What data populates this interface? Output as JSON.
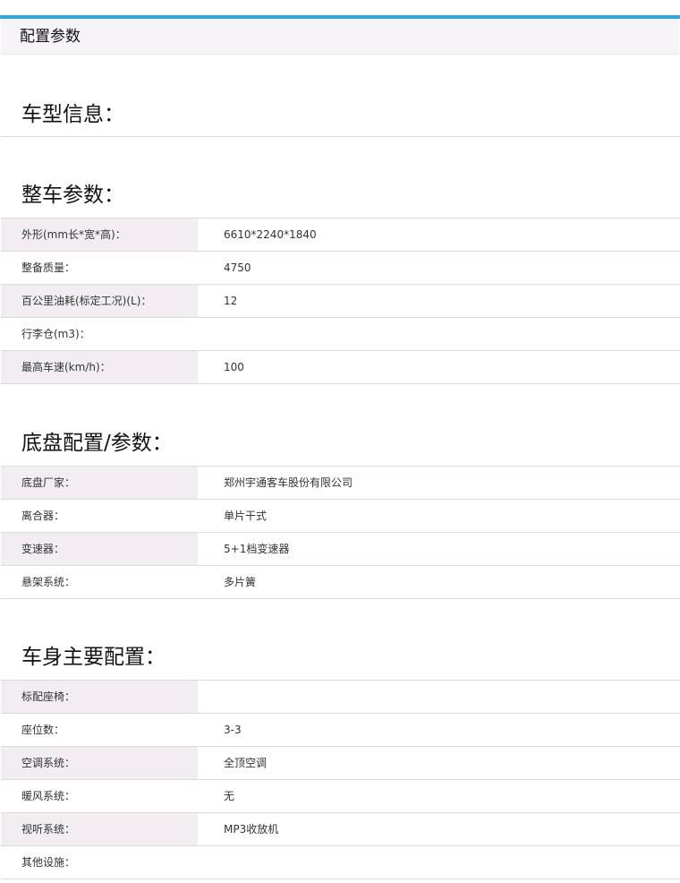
{
  "header": {
    "title": "配置参数"
  },
  "sections": [
    {
      "title": "车型信息：",
      "rows": []
    },
    {
      "title": "整车参数：",
      "rows": [
        {
          "label": "外形(mm长*宽*高)：",
          "value": "6610*2240*1840"
        },
        {
          "label": "整备质量：",
          "value": "4750"
        },
        {
          "label": "百公里油耗(标定工况)(L)：",
          "value": "12"
        },
        {
          "label": "行李仓(m3)：",
          "value": ""
        },
        {
          "label": "最高车速(km/h)：",
          "value": "100"
        }
      ]
    },
    {
      "title": "底盘配置/参数：",
      "rows": [
        {
          "label": "底盘厂家：",
          "value": "郑州宇通客车股份有限公司"
        },
        {
          "label": "离合器：",
          "value": "单片干式"
        },
        {
          "label": "变速器：",
          "value": "5+1档变速器"
        },
        {
          "label": "悬架系统：",
          "value": "多片簧"
        }
      ]
    },
    {
      "title": "车身主要配置：",
      "rows": [
        {
          "label": "标配座椅：",
          "value": ""
        },
        {
          "label": "座位数：",
          "value": "3-3"
        },
        {
          "label": "空调系统：",
          "value": "全顶空调"
        },
        {
          "label": "暖风系统：",
          "value": "无"
        },
        {
          "label": "视听系统：",
          "value": "MP3收放机"
        },
        {
          "label": "其他设施：",
          "value": ""
        }
      ]
    }
  ],
  "colors": {
    "accent_bar": "#2ea7e0",
    "header_bg": "#f7f4f7",
    "label_shade": "#f1edf1"
  }
}
